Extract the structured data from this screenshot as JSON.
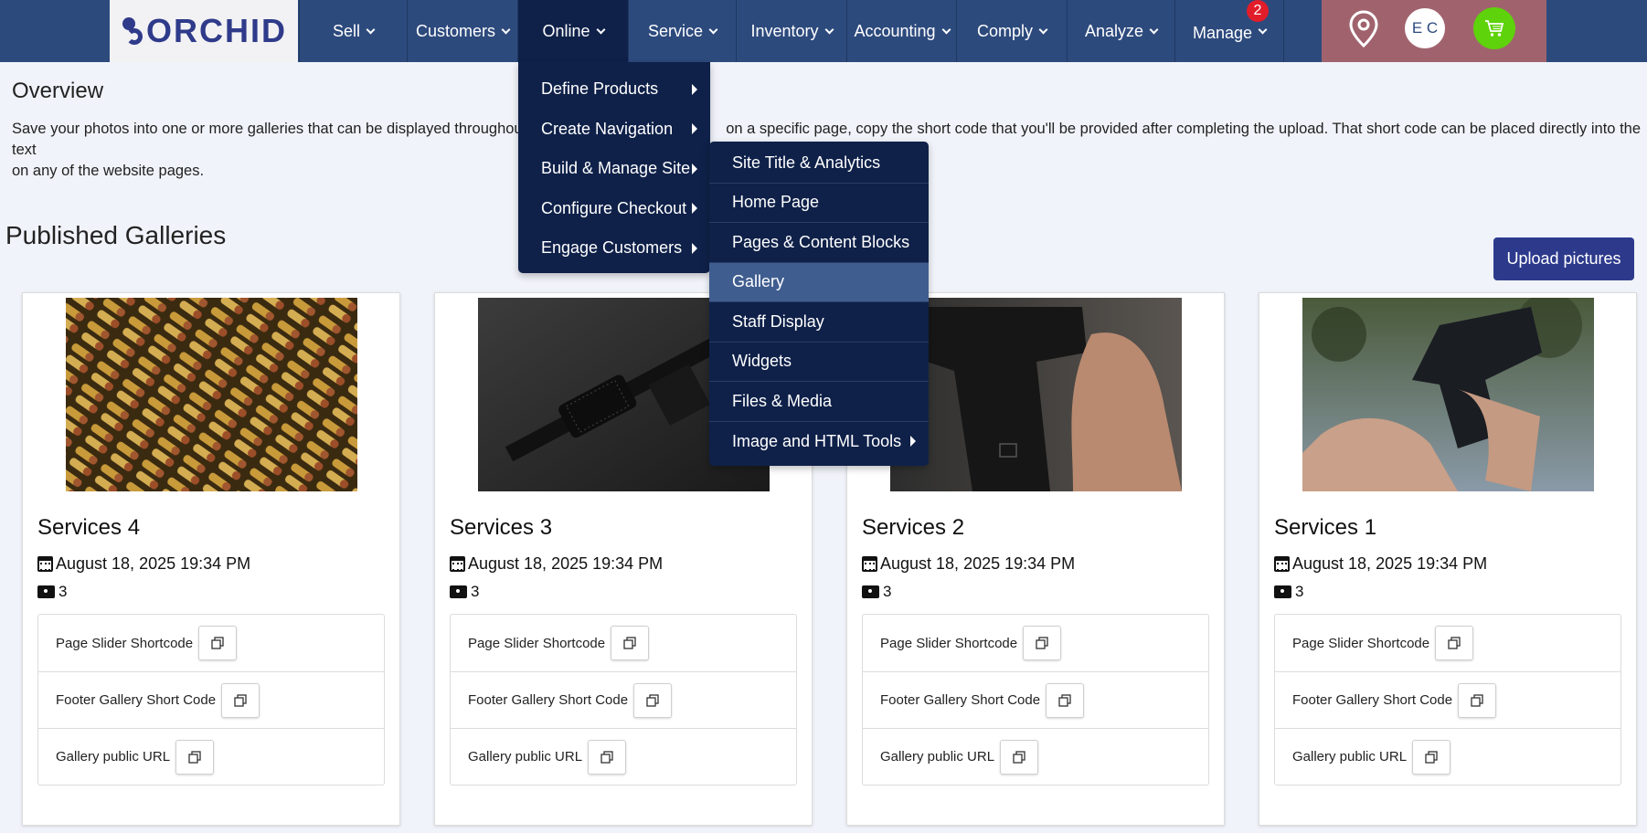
{
  "brand": {
    "logo_text": "ORCHID"
  },
  "nav": {
    "items": [
      {
        "label": "Sell"
      },
      {
        "label": "Customers"
      },
      {
        "label": "Online"
      },
      {
        "label": "Service"
      },
      {
        "label": "Inventory"
      },
      {
        "label": "Accounting"
      },
      {
        "label": "Comply"
      },
      {
        "label": "Analyze"
      },
      {
        "label": "Manage",
        "badge": "2"
      }
    ],
    "active": "Online",
    "avatar_initials": "E C",
    "icons": [
      "location-pin-icon",
      "cart-icon"
    ]
  },
  "online_menu": {
    "items": [
      {
        "label": "Define Products"
      },
      {
        "label": "Create Navigation"
      },
      {
        "label": "Build & Manage Site"
      },
      {
        "label": "Configure Checkout"
      },
      {
        "label": "Engage Customers"
      }
    ]
  },
  "site_submenu": {
    "items": [
      {
        "label": "Site Title & Analytics"
      },
      {
        "label": "Home Page"
      },
      {
        "label": "Pages & Content Blocks"
      },
      {
        "label": "Gallery"
      },
      {
        "label": "Staff Display"
      },
      {
        "label": "Widgets"
      },
      {
        "label": "Files & Media"
      },
      {
        "label": "Image and HTML Tools"
      }
    ],
    "highlighted": "Gallery"
  },
  "overview": {
    "title": "Overview",
    "description_left": "Save your photos into one or more galleries that can be displayed throughout",
    "description_right": "on a specific page, copy the short code that you'll be provided after completing the upload. That short code can be placed directly into the text",
    "description_line2": "on any of the website pages."
  },
  "galleries": {
    "title": "Published Galleries",
    "upload_label": "Upload pictures",
    "shortcode_labels": {
      "slider": "Page Slider Shortcode",
      "footer": "Footer Gallery Short Code",
      "url": "Gallery public URL"
    },
    "cards": [
      {
        "title": "Services 4",
        "date": "August 18, 2025 19:34 PM",
        "count": "3",
        "image": "ammunition-photo"
      },
      {
        "title": "Services 3",
        "date": "August 18, 2025 19:34 PM",
        "count": "3",
        "image": "rifle-photo"
      },
      {
        "title": "Services 2",
        "date": "August 18, 2025 19:34 PM",
        "count": "3",
        "image": "handgun-in-hand-photo"
      },
      {
        "title": "Services 1",
        "date": "August 18, 2025 19:34 PM",
        "count": "3",
        "image": "pistol-held-photo"
      }
    ]
  },
  "colors": {
    "nav_bg": "#2d4a7d",
    "nav_active": "#0f2149",
    "menu_highlight": "#3f5d8f",
    "upload_button": "#2d3a8c",
    "badge": "#e11d2a",
    "cart": "#5ed20b"
  }
}
